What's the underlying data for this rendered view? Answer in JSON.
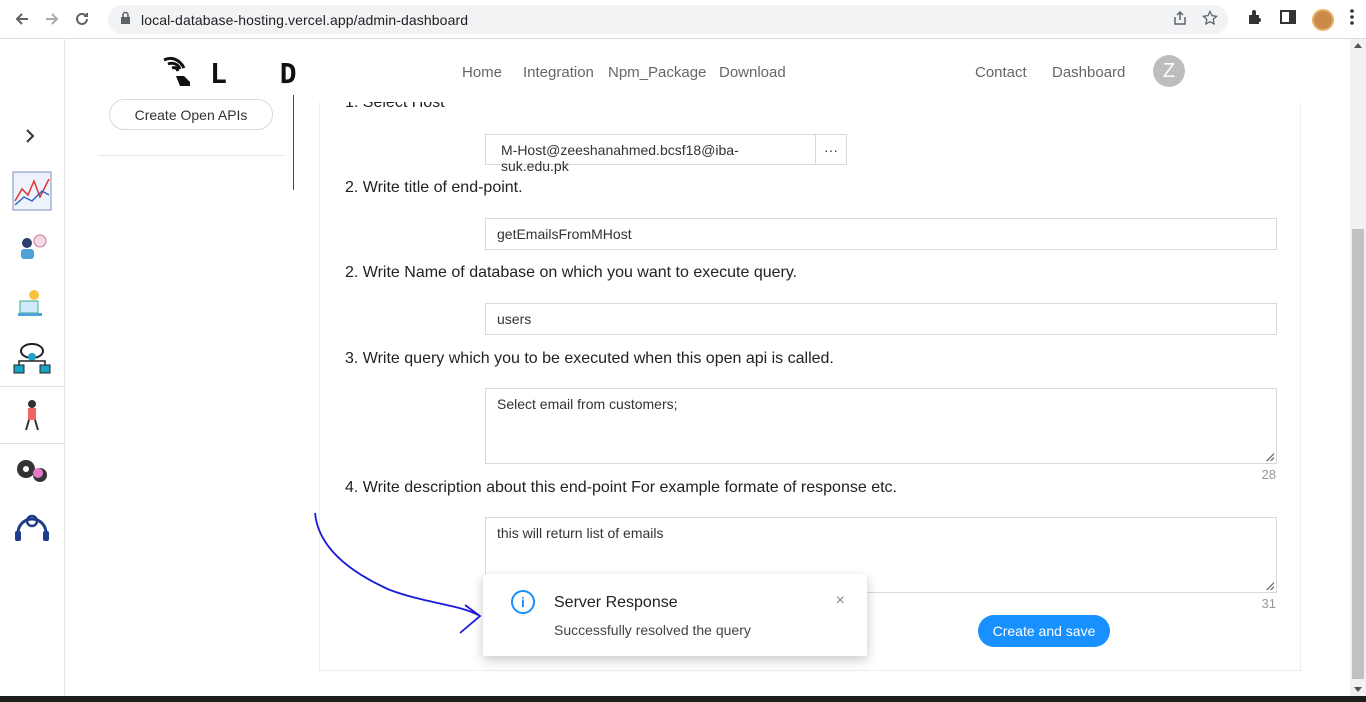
{
  "browser": {
    "url": "local-database-hosting.vercel.app/admin-dashboard"
  },
  "brand": {
    "text": "L D H"
  },
  "nav": {
    "home": "Home",
    "integration": "Integration",
    "npm": "Npm_Package",
    "download": "Download",
    "contact": "Contact",
    "dashboard": "Dashboard",
    "profile_initial": "Z"
  },
  "sidebar": {
    "create_button": "Create Open APIs"
  },
  "form": {
    "step1_label": "1. Select Host",
    "host_value": "M-Host@zeeshanahmed.bcsf18@iba-suk.edu.pk",
    "host_more": "···",
    "step2_label": "2. Write title of end-point.",
    "title_value": "getEmailsFromMHost",
    "step2b_label": "2. Write Name of database on which you want to execute query.",
    "db_value": "users",
    "step3_label": "3. Write query which you to be executed when this open api is called.",
    "query_value": "Select email from customers;",
    "query_count": "28",
    "step4_label": "4. Write description about this end-point For example formate of response etc.",
    "desc_value": "this will return list of emails",
    "desc_count": "31",
    "save_button": "Create and save"
  },
  "notification": {
    "title": "Server Response",
    "message": "Successfully resolved the query",
    "close": "×"
  },
  "colors": {
    "primary": "#1890ff",
    "annotation": "#1a1adb"
  }
}
